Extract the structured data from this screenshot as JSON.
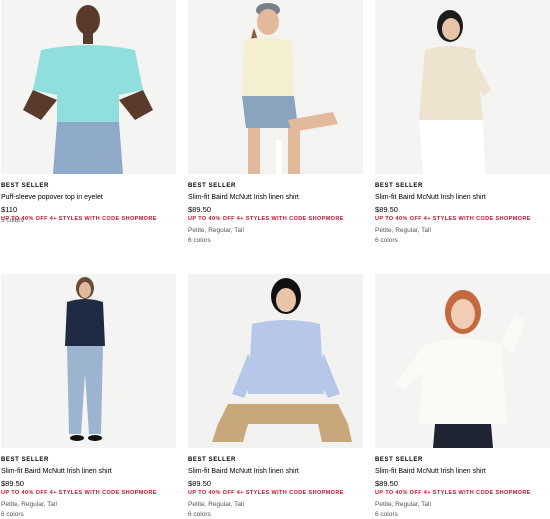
{
  "products": [
    {
      "badge": "BEST SELLER",
      "name": "Puff-sleeve popover top in eyelet",
      "price": "$110",
      "promo": "UP TO 40% OFF 4+ STYLES WITH CODE SHOPMORE",
      "sizes": "",
      "colors": "5 colors",
      "image_icon": "model-in-aqua-eyelet-top-photo"
    },
    {
      "badge": "BEST SELLER",
      "name": "Slim-fit Baird McNutt Irish linen shirt",
      "price": "$89.50",
      "promo": "UP TO 40% OFF 4+ STYLES WITH CODE SHOPMORE",
      "sizes": "Petite, Regular, Tall",
      "colors": "6 colors",
      "image_icon": "model-in-cream-linen-shirt-photo"
    },
    {
      "badge": "BEST SELLER",
      "name": "Slim-fit Baird McNutt Irish linen shirt",
      "price": "$89.50",
      "promo": "UP TO 40% OFF 4+ STYLES WITH CODE SHOPMORE",
      "sizes": "Petite, Regular, Tall",
      "colors": "6 colors",
      "image_icon": "model-in-beige-linen-shirt-photo"
    },
    {
      "badge": "BEST SELLER",
      "name": "Slim-fit Baird McNutt Irish linen shirt",
      "price": "$89.50",
      "promo": "UP TO 40% OFF 4+ STYLES WITH CODE SHOPMORE",
      "sizes": "Petite, Regular, Tall",
      "colors": "6 colors",
      "image_icon": "model-in-navy-linen-shirt-photo"
    },
    {
      "badge": "BEST SELLER",
      "name": "Slim-fit Baird McNutt Irish linen shirt",
      "price": "$89.50",
      "promo": "UP TO 40% OFF 4+ STYLES WITH CODE SHOPMORE",
      "sizes": "Petite, Regular, Tall",
      "colors": "6 colors",
      "image_icon": "model-in-blue-stripe-linen-shirt-photo"
    },
    {
      "badge": "BEST SELLER",
      "name": "Slim-fit Baird McNutt Irish linen shirt",
      "price": "$89.50",
      "promo": "UP TO 40% OFF 4+ STYLES WITH CODE SHOPMORE",
      "sizes": "Petite, Regular, Tall",
      "colors": "6 colors",
      "image_icon": "model-in-white-linen-shirt-photo"
    }
  ],
  "colors": {
    "promo": "#c8102e",
    "photo_bg": "#f2f2f2"
  }
}
